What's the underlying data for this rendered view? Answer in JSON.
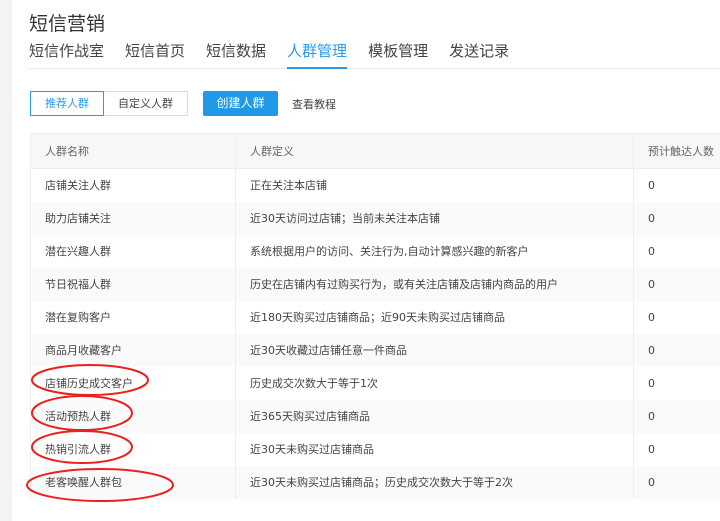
{
  "header": {
    "title": "短信营销"
  },
  "tabs": [
    {
      "label": "短信作战室"
    },
    {
      "label": "短信首页"
    },
    {
      "label": "短信数据"
    },
    {
      "label": "人群管理",
      "active": true
    },
    {
      "label": "模板管理"
    },
    {
      "label": "发送记录"
    }
  ],
  "toolbar": {
    "recommended": "推荐人群",
    "custom": "自定义人群",
    "create": "创建人群",
    "tutorial": "查看教程"
  },
  "table": {
    "columns": [
      "人群名称",
      "人群定义",
      "预计触达人数"
    ],
    "rows": [
      [
        "店铺关注人群",
        "正在关注本店铺",
        "0"
      ],
      [
        "助力店铺关注",
        "近30天访问过店铺；当前未关注本店铺",
        "0"
      ],
      [
        "潜在兴趣人群",
        "系统根据用户的访问、关注行为,自动计算感兴趣的新客户",
        "0"
      ],
      [
        "节日祝福人群",
        "历史在店铺内有过购买行为，或有关注店铺及店铺内商品的用户",
        "0"
      ],
      [
        "潜在复购客户",
        "近180天购买过店铺商品；近90天未购买过店铺商品",
        "0"
      ],
      [
        "商品月收藏客户",
        "近30天收藏过店铺任意一件商品",
        "0"
      ],
      [
        "店铺历史成交客户",
        "历史成交次数大于等于1次",
        "0"
      ],
      [
        "活动预热人群",
        "近365天购买过店铺商品",
        "0"
      ],
      [
        "热销引流人群",
        "近30天未购买过店铺商品",
        "0"
      ],
      [
        "老客唤醒人群包",
        "近30天未购买过店铺商品；历史成交次数大于等于2次",
        "0"
      ]
    ]
  },
  "colors": {
    "accent": "#1e9ae8",
    "annotation": "#e8221e"
  }
}
